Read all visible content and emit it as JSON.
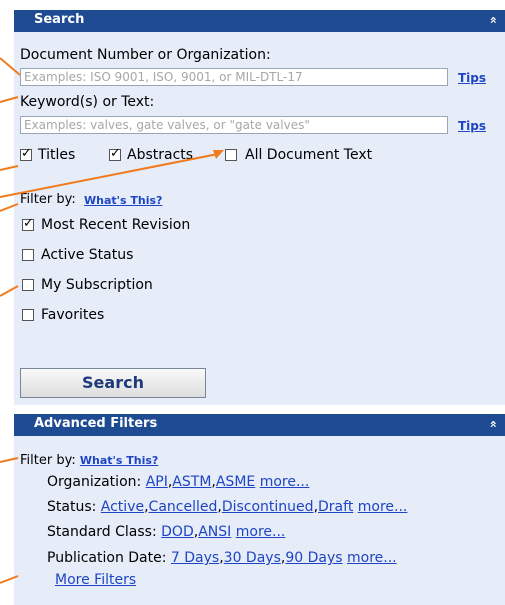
{
  "search_panel": {
    "title": "Search",
    "collapse_glyph": "»",
    "doc_label": "Document Number or Organization:",
    "doc_placeholder": "Examples: ISO 9001, ISO, 9001, or MIL-DTL-17",
    "keyword_label": "Keyword(s) or Text:",
    "keyword_placeholder": "Examples: valves, gate valves, or \"gate valves\"",
    "tips_label": "Tips",
    "scope": {
      "titles": {
        "label": "Titles",
        "checked": true
      },
      "abstracts": {
        "label": "Abstracts",
        "checked": true
      },
      "all_text": {
        "label": "All Document Text",
        "checked": false
      }
    },
    "filter_by_label": "Filter by:",
    "whats_this": "What's This?",
    "filters": [
      {
        "label": "Most Recent Revision",
        "checked": true
      },
      {
        "label": "Active Status",
        "checked": false
      },
      {
        "label": "My Subscription",
        "checked": false
      },
      {
        "label": "Favorites",
        "checked": false
      }
    ],
    "search_button": "Search"
  },
  "advanced_panel": {
    "title": "Advanced Filters",
    "collapse_glyph": "»",
    "filter_by_label": "Filter by:",
    "whats_this": "What's This?",
    "organization_label": "Organization:",
    "organization_links": [
      "API",
      "ASTM",
      "ASME"
    ],
    "status_label": "Status:",
    "status_links": [
      "Active",
      "Cancelled",
      "Discontinued",
      "Draft"
    ],
    "standard_class_label": "Standard Class:",
    "standard_class_links": [
      "DOD",
      "ANSI"
    ],
    "publication_date_label": "Publication Date:",
    "publication_date_links": [
      "7 Days",
      "30 Days",
      "90 Days"
    ],
    "more_label": "more...",
    "more_filters": "More Filters"
  },
  "annotation_color": "#f07a1c",
  "header_color": "#1f4b92",
  "panel_bg": "#e6ecf8"
}
